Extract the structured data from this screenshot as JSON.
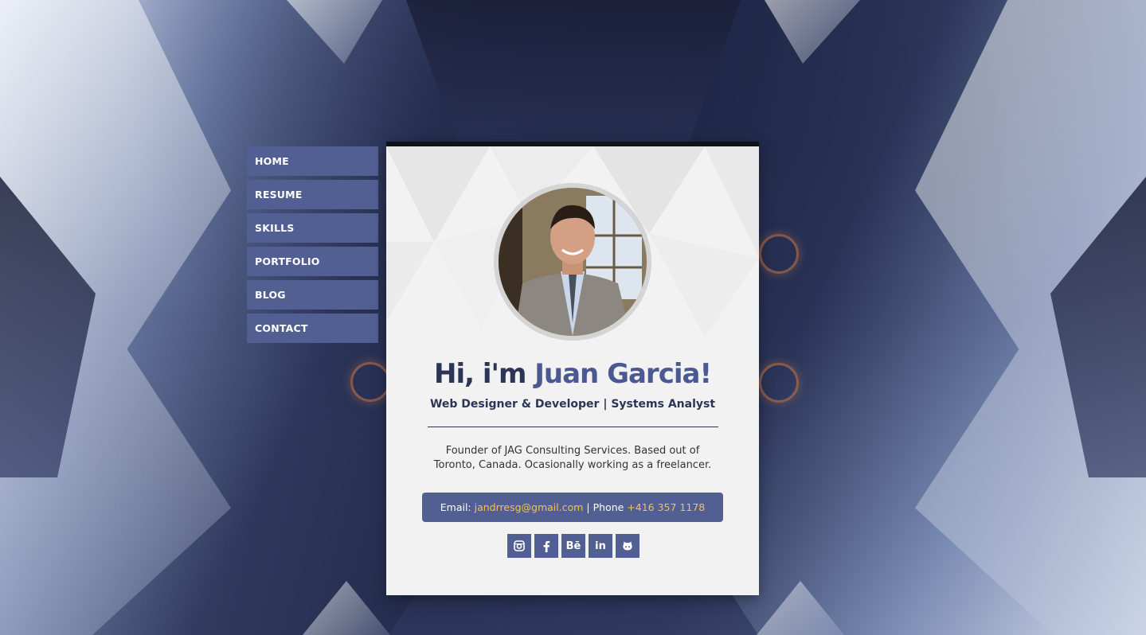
{
  "nav": {
    "items": [
      {
        "label": "HOME"
      },
      {
        "label": "RESUME"
      },
      {
        "label": "SKILLS"
      },
      {
        "label": "PORTFOLIO"
      },
      {
        "label": "BLOG"
      },
      {
        "label": "CONTACT"
      }
    ]
  },
  "profile": {
    "greeting": "Hi, i'm ",
    "name": "Juan Garcia!",
    "subtitle": "Web Designer & Developer | Systems Analyst",
    "bio": "Founder of JAG Consulting Services. Based out of Toronto, Canada. Ocasionally working as a freelancer."
  },
  "contact": {
    "email_label": "Email: ",
    "email": "jandrresg@gmail.com",
    "separator": " | Phone ",
    "phone": "+416 357 1178",
    "accent_color": "#f5c24a"
  },
  "social": [
    {
      "icon": "instagram-icon"
    },
    {
      "icon": "facebook-icon"
    },
    {
      "icon": "behance-icon",
      "glyph": "Bē"
    },
    {
      "icon": "linkedin-icon",
      "glyph": "in"
    },
    {
      "icon": "github-icon"
    }
  ],
  "colors": {
    "primary": "#525f93",
    "heading": "#2d3556",
    "name_accent": "#4b5891",
    "card_top_border": "#111216"
  }
}
